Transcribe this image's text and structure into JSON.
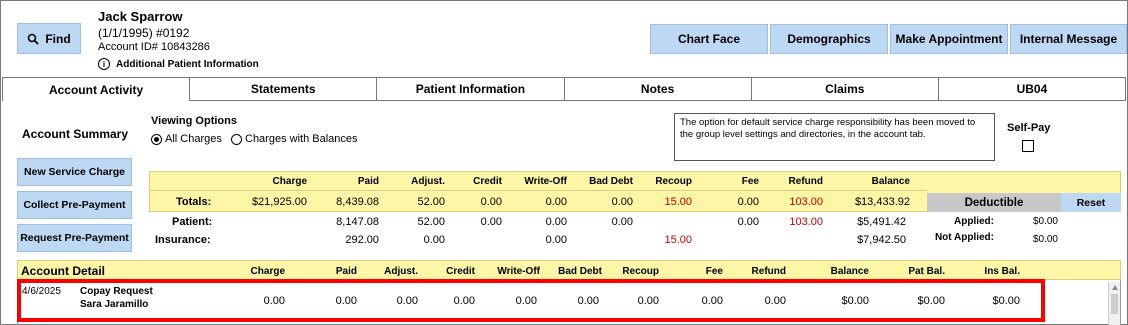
{
  "header": {
    "find_label": "Find",
    "patient_name": "Jack Sparrow",
    "patient_dob": "(1/1/1995) #0192",
    "account_id": "Account ID# 10843286",
    "additional_info": "Additional Patient Information",
    "buttons": [
      "Chart Face",
      "Demographics",
      "Make Appointment",
      "Internal Message"
    ]
  },
  "tabs": [
    "Account Activity",
    "Statements",
    "Patient Information",
    "Notes",
    "Claims",
    "UB04"
  ],
  "summary": {
    "title": "Account Summary",
    "viewing_label": "Viewing Options",
    "option_all": "All Charges",
    "option_balances": "Charges with Balances",
    "notice": "The option for default service charge responsibility has been moved to the group level settings and directories, in the account tab.",
    "self_pay": "Self-Pay"
  },
  "side_buttons": [
    "New Service Charge",
    "Collect Pre-Payment",
    "Request Pre-Payment"
  ],
  "totals": {
    "headers": [
      "Charge",
      "Paid",
      "Adjust.",
      "Credit",
      "Write-Off",
      "Bad Debt",
      "Recoup",
      "Fee",
      "Refund",
      "Balance"
    ],
    "totals_label": "Totals:",
    "totals_values": [
      "$21,925.00",
      "8,439.08",
      "52.00",
      "0.00",
      "0.00",
      "0.00",
      "15.00",
      "0.00",
      "103.00",
      "$13,433.92"
    ],
    "patient_label": "Patient:",
    "patient_values": [
      "",
      "8,147.08",
      "52.00",
      "0.00",
      "0.00",
      "0.00",
      "",
      "0.00",
      "103.00",
      "$5,491.42"
    ],
    "insurance_label": "Insurance:",
    "insurance_values": [
      "",
      "292.00",
      "0.00",
      "",
      "0.00",
      "",
      "15.00",
      "",
      "",
      "$7,942.50"
    ],
    "deductible_label": "Deductible",
    "reset_label": "Reset",
    "applied_label": "Applied:",
    "applied_value": "$0.00",
    "not_applied_label": "Not Applied:",
    "not_applied_value": "$0.00"
  },
  "detail": {
    "title": "Account Detail",
    "headers": [
      "Charge",
      "Paid",
      "Adjust.",
      "Credit",
      "Write-Off",
      "Bad Debt",
      "Recoup",
      "Fee",
      "Refund",
      "Balance",
      "Pat Bal.",
      "Ins Bal."
    ],
    "row": {
      "date": "4/6/2025",
      "desc": "Copay Request",
      "provider": "Sara Jaramillo",
      "values": [
        "0.00",
        "0.00",
        "0.00",
        "0.00",
        "0.00",
        "0.00",
        "0.00",
        "0.00",
        "0.00",
        "$0.00",
        "$0.00",
        "$0.00"
      ]
    }
  },
  "colors": {
    "button_blue": "#bcd8f3",
    "totals_yellow": "#fdf6a6",
    "highlight_red": "#ff0000",
    "negative_red": "#c00000"
  }
}
